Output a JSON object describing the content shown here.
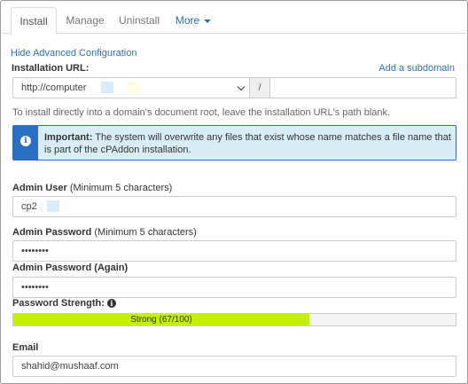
{
  "tabs": [
    {
      "label": "Install",
      "active": true
    },
    {
      "label": "Manage",
      "active": false
    },
    {
      "label": "Uninstall",
      "active": false
    },
    {
      "label": "More",
      "active": false
    }
  ],
  "advanced_link": "Hide Advanced Configuration",
  "installation_url": {
    "label": "Installation URL:",
    "subdomain_link": "Add a subdomain",
    "domain_value": "http://computer",
    "separator": "/",
    "path_value": "",
    "help": "To install directly into a domain's document root, leave the installation URL's path blank."
  },
  "alert": {
    "title": "Important:",
    "message": "The system will overwrite any files that exist whose name matches a file name that is part of the cPAddon installation.",
    "icon": "info-icon"
  },
  "admin_user": {
    "label": "Admin User",
    "hint": "(Minimum 5 characters)",
    "value": "cp2"
  },
  "admin_password": {
    "label": "Admin Password",
    "hint": "(Minimum 5 characters)",
    "value": "••••••••"
  },
  "admin_password_again": {
    "label": "Admin Password (Again)",
    "value": "••••••••"
  },
  "password_strength": {
    "label": "Password Strength:",
    "text": "Strong (67/100)",
    "value": 67,
    "max": 100,
    "color": "#c4f000"
  },
  "email": {
    "label": "Email",
    "value": "shahid@mushaaf.com"
  },
  "colors": {
    "accent": "#2a6fc2",
    "alert_bg": "#d9edf7"
  }
}
